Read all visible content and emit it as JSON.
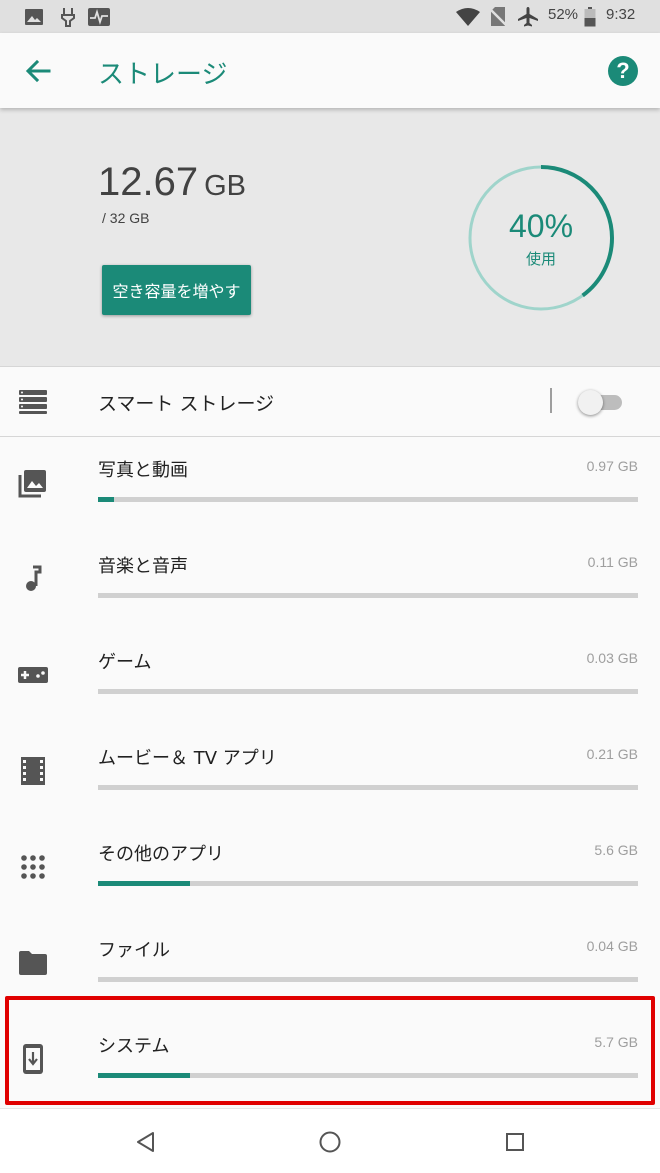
{
  "status_bar": {
    "icons": [
      "photo-icon",
      "usb-icon",
      "pulse-icon",
      "wifi-icon",
      "no-sim-icon",
      "airplane-icon",
      "battery-icon"
    ],
    "battery": "52%",
    "time": "9:32"
  },
  "header": {
    "title": "ストレージ",
    "back_icon": "arrow-left-icon",
    "help_icon": "help-icon",
    "help_glyph": "?"
  },
  "summary": {
    "used_value": "12.67",
    "used_unit": "GB",
    "total": "/ 32 GB",
    "free_up_button": "空き容量を増やす",
    "gauge_percent": "40%",
    "gauge_label": "使用",
    "gauge_fraction": 0.4
  },
  "smart_storage": {
    "label": "スマート ストレージ",
    "icon": "storage-list-icon",
    "enabled": false
  },
  "categories": [
    {
      "label": "写真と動画",
      "size": "0.97 GB",
      "icon": "photos-icon",
      "fraction": 0.03
    },
    {
      "label": "音楽と音声",
      "size": "0.11 GB",
      "icon": "music-note-icon",
      "fraction": 0.0
    },
    {
      "label": "ゲーム",
      "size": "0.03 GB",
      "icon": "gamepad-icon",
      "fraction": 0.0
    },
    {
      "label": "ムービー＆ TV アプリ",
      "size": "0.21 GB",
      "icon": "movie-icon",
      "fraction": 0.0
    },
    {
      "label": "その他のアプリ",
      "size": "5.6 GB",
      "icon": "apps-grid-icon",
      "fraction": 0.17
    },
    {
      "label": "ファイル",
      "size": "0.04 GB",
      "icon": "folder-icon",
      "fraction": 0.0
    },
    {
      "label": "システム",
      "size": "5.7 GB",
      "icon": "system-update-icon",
      "fraction": 0.17
    }
  ],
  "colors": {
    "accent": "#1b8a78",
    "highlight": "#e00000"
  },
  "nav_bar": {
    "back": "nav-back-icon",
    "home": "nav-home-icon",
    "recents": "nav-recents-icon"
  }
}
